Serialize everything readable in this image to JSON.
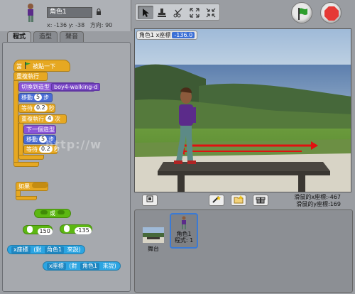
{
  "sprite": {
    "name": "角色1",
    "x_label": "x:",
    "x_value": "-136",
    "y_label": "y:",
    "y_value": "-38",
    "direction_label": "方向:",
    "direction_value": "90"
  },
  "tabs": [
    "程式",
    "造型",
    "聲音"
  ],
  "scripts": {
    "hat_label": "當",
    "hat_suffix": "被點一下",
    "forever_label": "重複執行",
    "switch_costume_label": "切換到造型",
    "costume_value": "boy4-walking-d",
    "move_label": "移動",
    "move_steps": "5",
    "steps_label": "步",
    "wait_label": "等待",
    "wait_value": "0.2",
    "seconds_label": "秒",
    "repeat_label": "重複執行",
    "repeat_count": "4",
    "repeat_suffix": "次",
    "next_costume_label": "下一個造型",
    "inner_move_steps": "5",
    "inner_wait_value": "0.2",
    "if_label": "如果",
    "or_label": "或",
    "lt_value": "150",
    "gt_value": "-135",
    "sensing_attr": "x座標",
    "sensing_of": "(對",
    "sensing_target": "角色1",
    "sensing_suffix": "來說)"
  },
  "stage": {
    "readout_label": "角色1 x座標",
    "readout_value": "-136.0"
  },
  "mouse": {
    "x_label": "滑鼠的x座標:",
    "x_value": "-467",
    "y_label": "滑鼠的y座標:",
    "y_value": "169"
  },
  "sprite_list": {
    "stage_label": "舞台",
    "sprite_name": "角色1",
    "sprite_scripts": "程式: 1"
  },
  "watermark": "http://w",
  "colors": {
    "control": "#e6a822",
    "looks": "#8a55d7",
    "motion": "#4a6cd4",
    "operators": "#5cb712",
    "sensing": "#2ca5e2",
    "arrow_red": "#e01010",
    "stop_red": "#e53935",
    "flag_green": "#2e9e2e"
  }
}
